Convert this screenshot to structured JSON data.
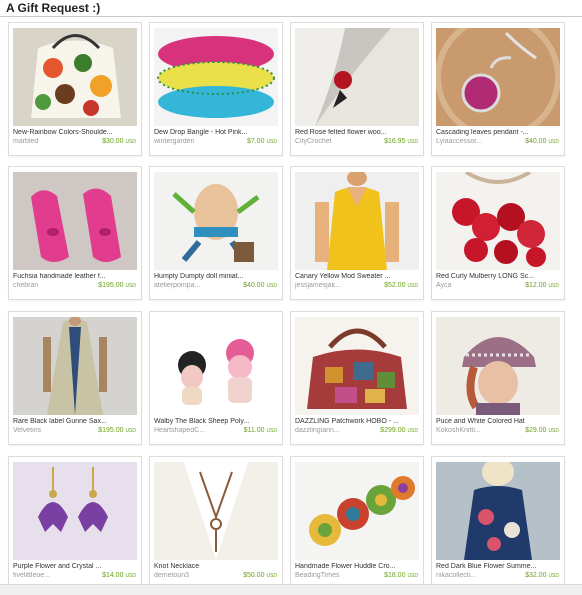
{
  "header": {
    "title": "A Gift Request :)"
  },
  "items": [
    {
      "name": "New-Rainbow Colors-Shoulde...",
      "seller": "marbled",
      "price": "$30.00",
      "currency": "USD",
      "icon": "flower-bag-thumb"
    },
    {
      "name": "Dew Drop Bangle - Hot Pink...",
      "seller": "wintergarden",
      "price": "$7.00",
      "currency": "USD",
      "icon": "bangle-thumb"
    },
    {
      "name": "Red Rose felted flower woo...",
      "seller": "CityCrochet",
      "price": "$16.95",
      "currency": "USD",
      "icon": "rose-brooch-thumb"
    },
    {
      "name": "Cascading leaves pendant -...",
      "seller": "Lyiaaccessor...",
      "price": "$40.00",
      "currency": "USD",
      "icon": "pendant-thumb"
    },
    {
      "name": "Fuchsia handmade leather f...",
      "seller": "chebran",
      "price": "$195.00",
      "currency": "USD",
      "icon": "pink-shoes-thumb"
    },
    {
      "name": "Humpty Dumpty doll miniat...",
      "seller": "atelierpompa...",
      "price": "$40.00",
      "currency": "USD",
      "icon": "humpty-doll-thumb"
    },
    {
      "name": "Canary Yellow Mod Sweater ...",
      "seller": "jessjamesjak...",
      "price": "$52.00",
      "currency": "USD",
      "icon": "yellow-sweater-thumb"
    },
    {
      "name": "Red Curly Mulberry LONG Sc...",
      "seller": "Ayca",
      "price": "$12.00",
      "currency": "USD",
      "icon": "red-scarf-thumb"
    },
    {
      "name": "Rare Black label Gunne Sax...",
      "seller": "Velvetiris",
      "price": "$195.00",
      "currency": "USD",
      "icon": "dress-thumb"
    },
    {
      "name": "Walby The Black Sheep Poly...",
      "seller": "HeartshapedC...",
      "price": "$11.00",
      "currency": "USD",
      "icon": "sheep-thumb"
    },
    {
      "name": "DAZZLING Patchwork HOBO - ...",
      "seller": "dazzlingiann...",
      "price": "$299.00",
      "currency": "USD",
      "icon": "hobo-bag-thumb"
    },
    {
      "name": "Puce and White Colored Hat",
      "seller": "KokoshKnitti...",
      "price": "$29.00",
      "currency": "USD",
      "icon": "knit-hat-thumb"
    },
    {
      "name": "Purple Flower and Crystal ...",
      "seller": "fivelittleoe...",
      "price": "$14.00",
      "currency": "USD",
      "icon": "earrings-thumb"
    },
    {
      "name": "Knot Necklace",
      "seller": "demetoun3",
      "price": "$50.00",
      "currency": "USD",
      "icon": "knot-necklace-thumb"
    },
    {
      "name": "Handmade Flower Huddle Cro...",
      "seller": "BeadingTimes",
      "price": "$18.00",
      "currency": "USD",
      "icon": "crochet-flowers-thumb"
    },
    {
      "name": "Red Dark Blue Flower Summe...",
      "seller": "nikacollecti...",
      "price": "$32.00",
      "currency": "USD",
      "icon": "blue-dress-thumb"
    }
  ],
  "colors": {
    "price": "#6aa31b",
    "seller": "#9a9a9a",
    "border": "#dcdcdc"
  }
}
